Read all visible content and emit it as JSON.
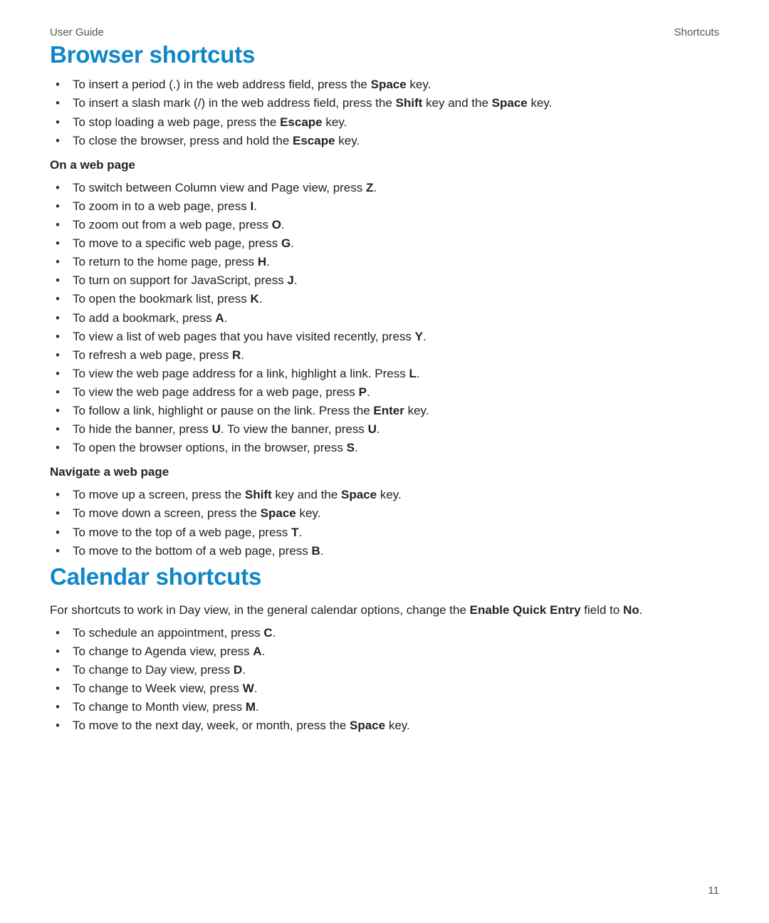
{
  "header": {
    "left": "User Guide",
    "right": "Shortcuts"
  },
  "page_number": "11",
  "sections": {
    "browser": {
      "title": "Browser shortcuts",
      "groups": [
        {
          "subhead": null,
          "items": [
            [
              {
                "t": "To insert a period (.) in the web address field, press the "
              },
              {
                "t": "Space",
                "b": true
              },
              {
                "t": " key."
              }
            ],
            [
              {
                "t": "To insert a slash mark (/) in the web address field, press the "
              },
              {
                "t": "Shift",
                "b": true
              },
              {
                "t": " key and the "
              },
              {
                "t": "Space",
                "b": true
              },
              {
                "t": " key."
              }
            ],
            [
              {
                "t": "To stop loading a web page, press the "
              },
              {
                "t": "Escape",
                "b": true
              },
              {
                "t": " key."
              }
            ],
            [
              {
                "t": "To close the browser, press and hold the "
              },
              {
                "t": "Escape",
                "b": true
              },
              {
                "t": " key."
              }
            ]
          ]
        },
        {
          "subhead": "On a web page",
          "items": [
            [
              {
                "t": "To switch between Column view and Page view, press "
              },
              {
                "t": "Z",
                "b": true
              },
              {
                "t": "."
              }
            ],
            [
              {
                "t": "To zoom in to a web page, press "
              },
              {
                "t": "I",
                "b": true
              },
              {
                "t": "."
              }
            ],
            [
              {
                "t": "To zoom out from a web page, press "
              },
              {
                "t": "O",
                "b": true
              },
              {
                "t": "."
              }
            ],
            [
              {
                "t": "To move to a specific web page, press "
              },
              {
                "t": "G",
                "b": true
              },
              {
                "t": "."
              }
            ],
            [
              {
                "t": "To return to the home page, press "
              },
              {
                "t": "H",
                "b": true
              },
              {
                "t": "."
              }
            ],
            [
              {
                "t": "To turn on support for JavaScript, press "
              },
              {
                "t": "J",
                "b": true
              },
              {
                "t": "."
              }
            ],
            [
              {
                "t": "To open the bookmark list, press "
              },
              {
                "t": "K",
                "b": true
              },
              {
                "t": "."
              }
            ],
            [
              {
                "t": "To add a bookmark, press "
              },
              {
                "t": "A",
                "b": true
              },
              {
                "t": "."
              }
            ],
            [
              {
                "t": "To view a list of web pages that you have visited recently, press "
              },
              {
                "t": "Y",
                "b": true
              },
              {
                "t": "."
              }
            ],
            [
              {
                "t": "To refresh a web page, press "
              },
              {
                "t": "R",
                "b": true
              },
              {
                "t": "."
              }
            ],
            [
              {
                "t": "To view the web page address for a link, highlight a link. Press "
              },
              {
                "t": "L",
                "b": true
              },
              {
                "t": "."
              }
            ],
            [
              {
                "t": "To view the web page address for a web page, press "
              },
              {
                "t": "P",
                "b": true
              },
              {
                "t": "."
              }
            ],
            [
              {
                "t": "To follow a link, highlight or pause on the link. Press the "
              },
              {
                "t": "Enter",
                "b": true
              },
              {
                "t": " key."
              }
            ],
            [
              {
                "t": "To hide the banner, press "
              },
              {
                "t": "U",
                "b": true
              },
              {
                "t": ". To view the banner, press "
              },
              {
                "t": "U",
                "b": true
              },
              {
                "t": "."
              }
            ],
            [
              {
                "t": "To open the browser options, in the browser, press "
              },
              {
                "t": "S",
                "b": true
              },
              {
                "t": "."
              }
            ]
          ]
        },
        {
          "subhead": "Navigate a web page",
          "items": [
            [
              {
                "t": "To move up a screen, press the "
              },
              {
                "t": "Shift",
                "b": true
              },
              {
                "t": " key and the "
              },
              {
                "t": "Space",
                "b": true
              },
              {
                "t": " key."
              }
            ],
            [
              {
                "t": "To move down a screen, press the "
              },
              {
                "t": "Space",
                "b": true
              },
              {
                "t": " key."
              }
            ],
            [
              {
                "t": "To move to the top of a web page, press "
              },
              {
                "t": "T",
                "b": true
              },
              {
                "t": "."
              }
            ],
            [
              {
                "t": "To move to the bottom of a web page, press "
              },
              {
                "t": "B",
                "b": true
              },
              {
                "t": "."
              }
            ]
          ]
        }
      ]
    },
    "calendar": {
      "title": "Calendar shortcuts",
      "intro": [
        {
          "t": "For shortcuts to work in Day view, in the general calendar options, change the "
        },
        {
          "t": "Enable Quick Entry",
          "b": true
        },
        {
          "t": " field to "
        },
        {
          "t": "No",
          "b": true
        },
        {
          "t": "."
        }
      ],
      "items": [
        [
          {
            "t": "To schedule an appointment, press "
          },
          {
            "t": "C",
            "b": true
          },
          {
            "t": "."
          }
        ],
        [
          {
            "t": "To change to Agenda view, press "
          },
          {
            "t": "A",
            "b": true
          },
          {
            "t": "."
          }
        ],
        [
          {
            "t": "To change to Day view, press "
          },
          {
            "t": "D",
            "b": true
          },
          {
            "t": "."
          }
        ],
        [
          {
            "t": "To change to Week view, press "
          },
          {
            "t": "W",
            "b": true
          },
          {
            "t": "."
          }
        ],
        [
          {
            "t": "To change to Month view, press "
          },
          {
            "t": "M",
            "b": true
          },
          {
            "t": "."
          }
        ],
        [
          {
            "t": "To move to the next day, week, or month, press the "
          },
          {
            "t": "Space",
            "b": true
          },
          {
            "t": " key."
          }
        ]
      ]
    }
  }
}
